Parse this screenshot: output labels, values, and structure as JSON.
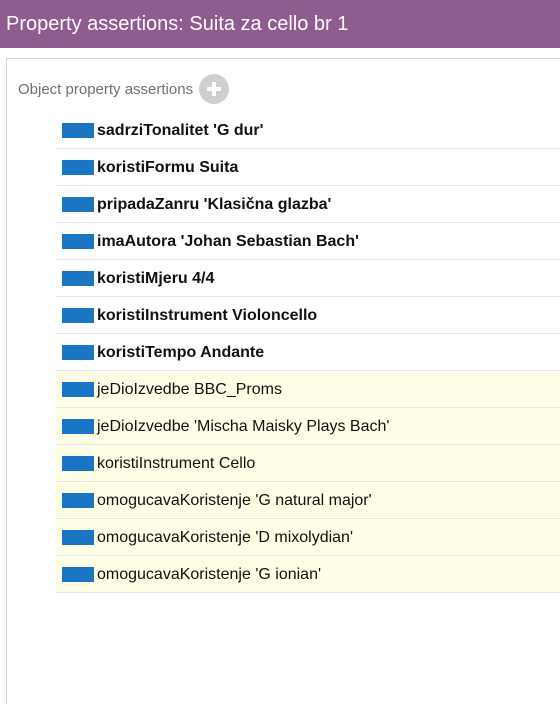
{
  "header": {
    "title": "Property assertions: Suita za cello br 1"
  },
  "section": {
    "label": "Object property assertions"
  },
  "icons": {
    "add": "plus-icon",
    "property": "object-property-icon"
  },
  "colors": {
    "title_bar": "#8f5c8f",
    "property_chip": "#1a75c2",
    "inferred_row": "#fefee6"
  },
  "assertions": [
    {
      "text": "sadrziTonalitet  'G dur'",
      "inferred": false
    },
    {
      "text": "koristiFormu  Suita",
      "inferred": false
    },
    {
      "text": "pripadaZanru  'Klasična glazba'",
      "inferred": false
    },
    {
      "text": "imaAutora  'Johan Sebastian Bach'",
      "inferred": false
    },
    {
      "text": "koristiMjeru  4/4",
      "inferred": false
    },
    {
      "text": "koristiInstrument  Violoncello",
      "inferred": false
    },
    {
      "text": "koristiTempo  Andante",
      "inferred": false
    },
    {
      "text": "jeDioIzvedbe  BBC_Proms",
      "inferred": true
    },
    {
      "text": "jeDioIzvedbe  'Mischa Maisky Plays Bach'",
      "inferred": true
    },
    {
      "text": "koristiInstrument  Cello",
      "inferred": true
    },
    {
      "text": "omogucavaKoristenje  'G natural major'",
      "inferred": true
    },
    {
      "text": "omogucavaKoristenje  'D mixolydian'",
      "inferred": true
    },
    {
      "text": "omogucavaKoristenje  'G ionian'",
      "inferred": true
    }
  ]
}
